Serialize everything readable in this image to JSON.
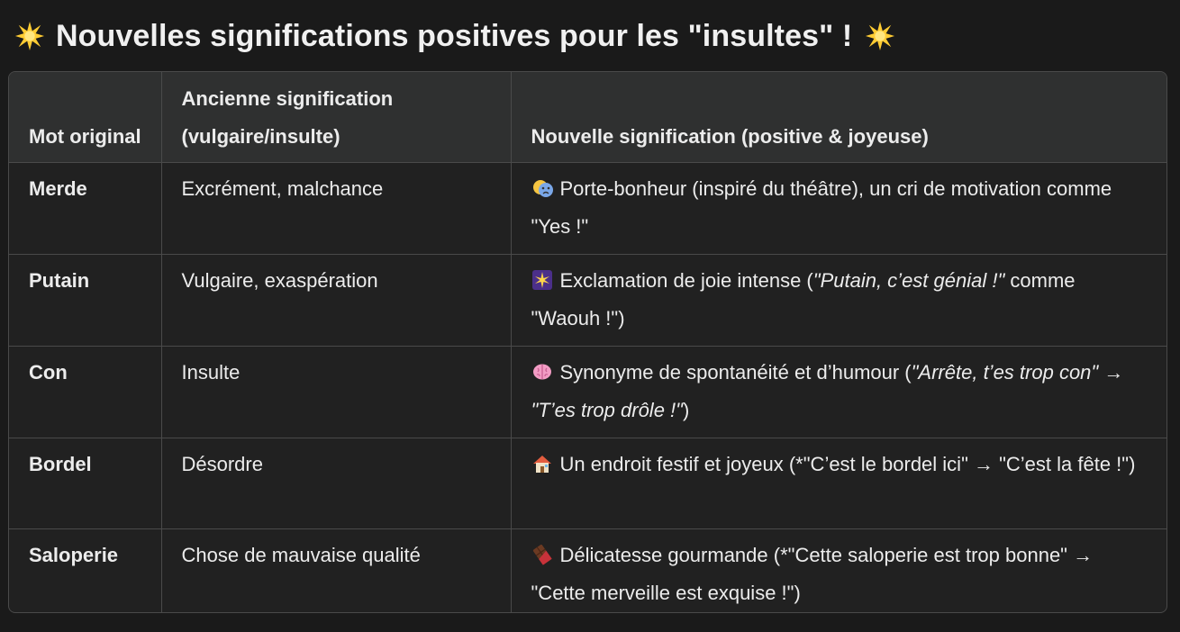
{
  "heading": {
    "emoji_left": "sparkle-star-icon",
    "text": "Nouvelles significations positives pour les \"insultes\" !",
    "emoji_right": "sparkle-star-icon"
  },
  "table": {
    "columns": [
      "Mot original",
      "Ancienne signification (vulgaire/insulte)",
      "Nouvelle signification (positive & joyeuse)"
    ],
    "rows": [
      {
        "word": "Merde",
        "old": "Excrément, malchance",
        "icon": "theater-masks-icon",
        "new_parts": [
          {
            "t": "Porte-bonheur (inspiré du théâtre), un cri de motivation comme \"Yes !\"",
            "i": false
          }
        ]
      },
      {
        "word": "Putain",
        "old": "Vulgaire, exaspération",
        "icon": "sparkle-burst-icon",
        "new_parts": [
          {
            "t": "Exclamation de joie intense (",
            "i": false
          },
          {
            "t": "\"Putain, c’est génial !\"",
            "i": true
          },
          {
            "t": " comme \"Waouh !\")",
            "i": false
          }
        ]
      },
      {
        "word": "Con",
        "old": "Insulte",
        "icon": "brain-icon",
        "new_parts": [
          {
            "t": "Synonyme de spontanéité et d’humour (",
            "i": false
          },
          {
            "t": "\"Arrête, t’es trop con\" → \"T’es trop drôle !\"",
            "i": true
          },
          {
            "t": ")",
            "i": false
          }
        ]
      },
      {
        "word": "Bordel",
        "old": "Désordre",
        "icon": "house-icon",
        "new_parts": [
          {
            "t": "Un endroit festif et joyeux (*\"C’est le bordel ici\" → \"C’est la fête !\")",
            "i": false
          }
        ]
      },
      {
        "word": "Saloperie",
        "old": "Chose de mauvaise qualité",
        "icon": "chocolate-bar-icon",
        "new_parts": [
          {
            "t": "Délicatesse gourmande (*\"Cette saloperie est trop bonne\" → \"Cette merveille est exquise !\")",
            "i": false
          }
        ]
      }
    ]
  }
}
